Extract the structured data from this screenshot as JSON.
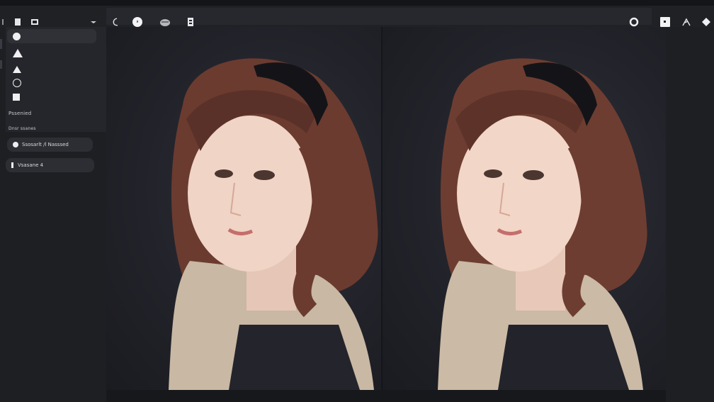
{
  "toolbar": {
    "left_icons": [
      "document-icon",
      "folder-icon",
      "dropdown-arrow-icon",
      "lasso-icon",
      "circle-tool-icon",
      "brush-icon",
      "layers-icon"
    ],
    "right_icons": [
      "ring-icon",
      "square-button-icon",
      "wand-icon",
      "diamond-icon"
    ]
  },
  "sidebar": {
    "shapes": [
      "circle",
      "triangle",
      "triangle-small",
      "circle-outline",
      "square"
    ],
    "section_label": "Pssenied",
    "subsection_label": "Dnsr ssanes",
    "pill_1_label": "Ssosarlt /l Nasssed",
    "pill_2_label": "Vsasane 4"
  },
  "canvas": {
    "left_image": "portrait-original",
    "right_image": "portrait-edited"
  },
  "colors": {
    "background": "#1b1c20",
    "toolbar": "#27282d",
    "panel": "#25262b",
    "pill": "#2d2e34",
    "icon": "#f0f0f2"
  }
}
